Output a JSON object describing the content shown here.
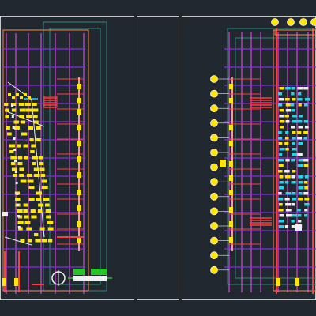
{
  "viewport": {
    "background": "#212830",
    "sheet_border_color": "#c8c8c8",
    "grid_color": "#ff4cff",
    "purple_color": "#8a2be2",
    "cyan_color": "#25d4e6",
    "red_color": "#ff3b3b",
    "yellow_color": "#ffe600",
    "green_color": "#26c626",
    "white_color": "#f0f0f0"
  },
  "left_plan": {
    "name": "floor-plan-left"
  },
  "right_plan": {
    "name": "floor-plan-right",
    "grid_bubble_count": 14
  },
  "top_bubble_count": 4
}
